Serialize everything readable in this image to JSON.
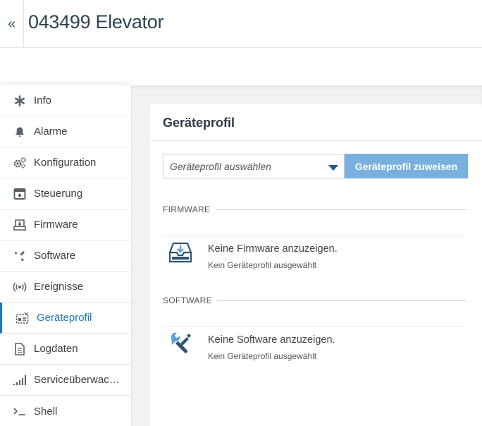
{
  "header": {
    "back_label": "«",
    "title": "043499 Elevator"
  },
  "sidebar": {
    "items": [
      {
        "label": "Info",
        "icon": "asterisk-icon"
      },
      {
        "label": "Alarme",
        "icon": "bell-icon"
      },
      {
        "label": "Konfiguration",
        "icon": "gears-icon"
      },
      {
        "label": "Steuerung",
        "icon": "control-panel-icon"
      },
      {
        "label": "Firmware",
        "icon": "firmware-icon"
      },
      {
        "label": "Software",
        "icon": "tools-icon"
      },
      {
        "label": "Ereignisse",
        "icon": "broadcast-icon"
      },
      {
        "label": "Geräteprofil",
        "icon": "device-profile-icon",
        "active": true
      },
      {
        "label": "Logdaten",
        "icon": "document-icon"
      },
      {
        "label": "Serviceüberwac…",
        "icon": "signal-bars-icon"
      },
      {
        "label": "Shell",
        "icon": "terminal-icon"
      }
    ]
  },
  "card": {
    "title": "Geräteprofil",
    "select_placeholder": "Geräteprofil auswählen",
    "assign_label": "Geräteprofil zuweisen",
    "firmware": {
      "section_label": "FIRMWARE",
      "empty_title": "Keine Firmware anzuzeigen.",
      "empty_sub": "Kein Geräteprofil ausgewählt"
    },
    "software": {
      "section_label": "SOFTWARE",
      "empty_title": "Keine Software anzuzeigen.",
      "empty_sub": "Kein Geräteprofil ausgewählt"
    }
  },
  "colors": {
    "accent": "#1b76c4",
    "button": "#7ab0de",
    "title": "#2d4356"
  }
}
